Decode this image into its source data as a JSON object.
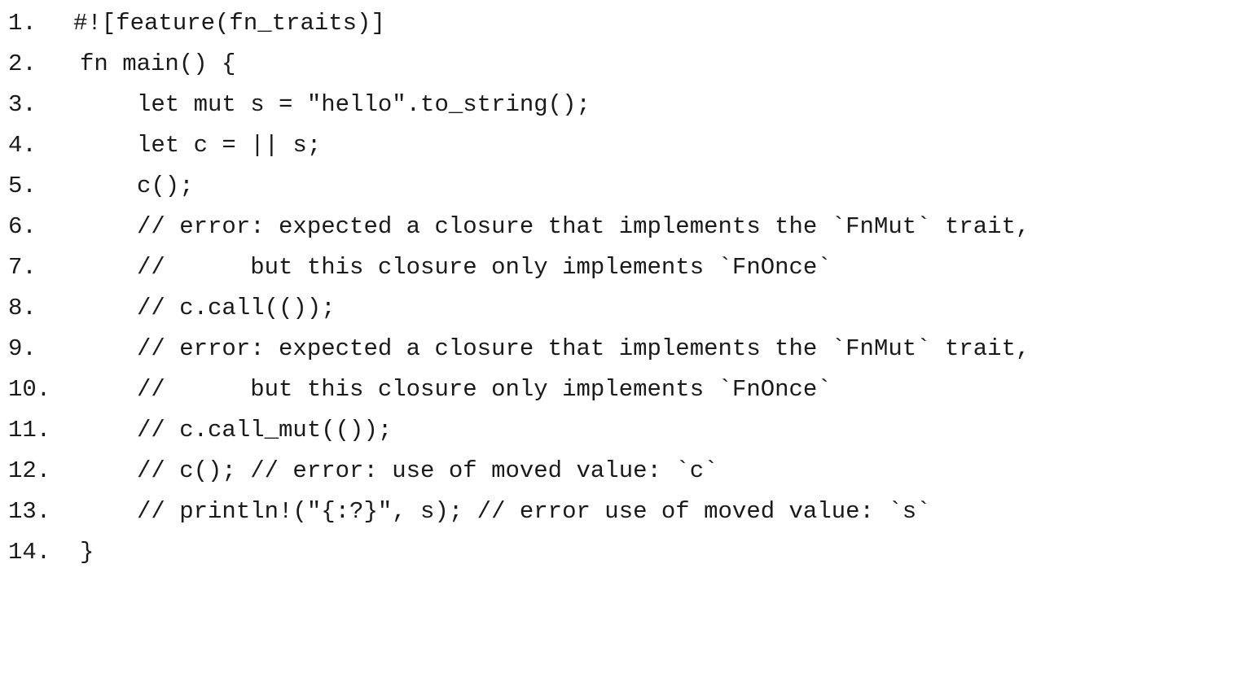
{
  "code": {
    "lines": [
      {
        "number": "1.",
        "text": "#![feature(fn_traits)]"
      },
      {
        "number": "2.",
        "text": "fn main() {"
      },
      {
        "number": "3.",
        "text": "let mut s = \"hello\".to_string();"
      },
      {
        "number": "4.",
        "text": "let c = || s;"
      },
      {
        "number": "5.",
        "text": "c();"
      },
      {
        "number": "6.",
        "text": "// error: expected a closure that implements the `FnMut` trait,"
      },
      {
        "number": "7.",
        "text": "//      but this closure only implements `FnOnce`"
      },
      {
        "number": "8.",
        "text": "// c.call(());"
      },
      {
        "number": "9.",
        "text": "// error: expected a closure that implements the `FnMut` trait,"
      },
      {
        "number": "10.",
        "text": "//      but this closure only implements `FnOnce`"
      },
      {
        "number": "11.",
        "text": "// c.call_mut(());"
      },
      {
        "number": "12.",
        "text": "// c(); // error: use of moved value: `c`"
      },
      {
        "number": "13.",
        "text": "// println!(\"{:?}\", s); // error use of moved value: `s`"
      },
      {
        "number": "14.",
        "text": "}"
      }
    ]
  }
}
